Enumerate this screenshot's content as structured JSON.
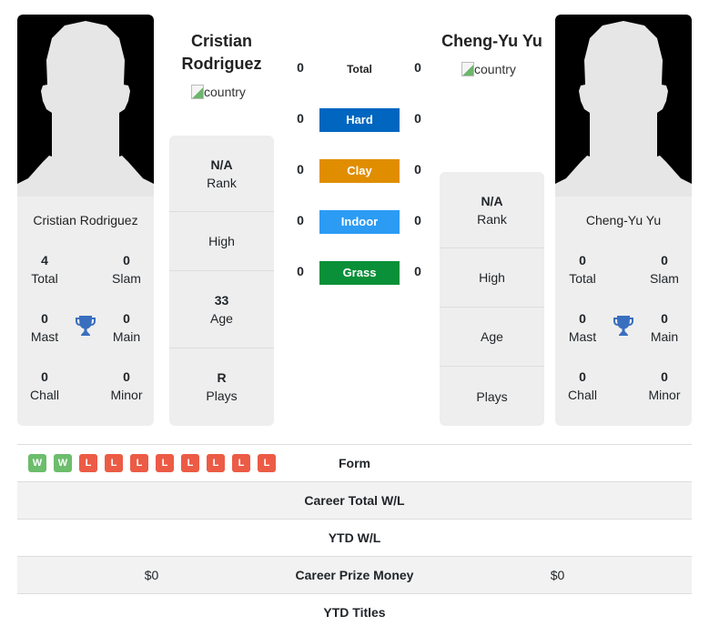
{
  "player1": {
    "name_heading": "Cristian Rodriguez",
    "name_heading_line1": "Cristian",
    "name_heading_line2": "Rodriguez",
    "flag_alt": "country",
    "card_name": "Cristian Rodriguez",
    "titles": {
      "total": {
        "value": "4",
        "label": "Total"
      },
      "slam": {
        "value": "0",
        "label": "Slam"
      },
      "mast": {
        "value": "0",
        "label": "Mast"
      },
      "main": {
        "value": "0",
        "label": "Main"
      },
      "chall": {
        "value": "0",
        "label": "Chall"
      },
      "minor": {
        "value": "0",
        "label": "Minor"
      }
    },
    "info": {
      "rank": {
        "value": "N/A",
        "label": "Rank"
      },
      "high": {
        "value": "",
        "label": "High"
      },
      "age": {
        "value": "33",
        "label": "Age"
      },
      "plays": {
        "value": "R",
        "label": "Plays"
      }
    }
  },
  "player2": {
    "name_heading": "Cheng-Yu Yu",
    "flag_alt": "country",
    "card_name": "Cheng-Yu Yu",
    "titles": {
      "total": {
        "value": "0",
        "label": "Total"
      },
      "slam": {
        "value": "0",
        "label": "Slam"
      },
      "mast": {
        "value": "0",
        "label": "Mast"
      },
      "main": {
        "value": "0",
        "label": "Main"
      },
      "chall": {
        "value": "0",
        "label": "Chall"
      },
      "minor": {
        "value": "0",
        "label": "Minor"
      }
    },
    "info": {
      "rank": {
        "value": "N/A",
        "label": "Rank"
      },
      "high": {
        "value": "",
        "label": "High"
      },
      "age": {
        "value": "",
        "label": "Age"
      },
      "plays": {
        "value": "",
        "label": "Plays"
      }
    }
  },
  "surfaces": [
    {
      "label": "Total",
      "p1": "0",
      "p2": "0",
      "color": ""
    },
    {
      "label": "Hard",
      "p1": "0",
      "p2": "0",
      "color": "#0066c0"
    },
    {
      "label": "Clay",
      "p1": "0",
      "p2": "0",
      "color": "#e08e00"
    },
    {
      "label": "Indoor",
      "p1": "0",
      "p2": "0",
      "color": "#2b9bf4"
    },
    {
      "label": "Grass",
      "p1": "0",
      "p2": "0",
      "color": "#0a9038"
    }
  ],
  "form": [
    "W",
    "W",
    "L",
    "L",
    "L",
    "L",
    "L",
    "L",
    "L",
    "L"
  ],
  "comparison": [
    {
      "label": "Form",
      "p1": "",
      "p2": ""
    },
    {
      "label": "Career Total W/L",
      "p1": "",
      "p2": ""
    },
    {
      "label": "YTD W/L",
      "p1": "",
      "p2": ""
    },
    {
      "label": "Career Prize Money",
      "p1": "$0",
      "p2": "$0"
    },
    {
      "label": "YTD Titles",
      "p1": "",
      "p2": ""
    }
  ],
  "colors": {
    "card_bg": "#eeeeee",
    "trophy": "#3a6fbf",
    "win": "#6cbd6c",
    "loss": "#ec5b45"
  }
}
